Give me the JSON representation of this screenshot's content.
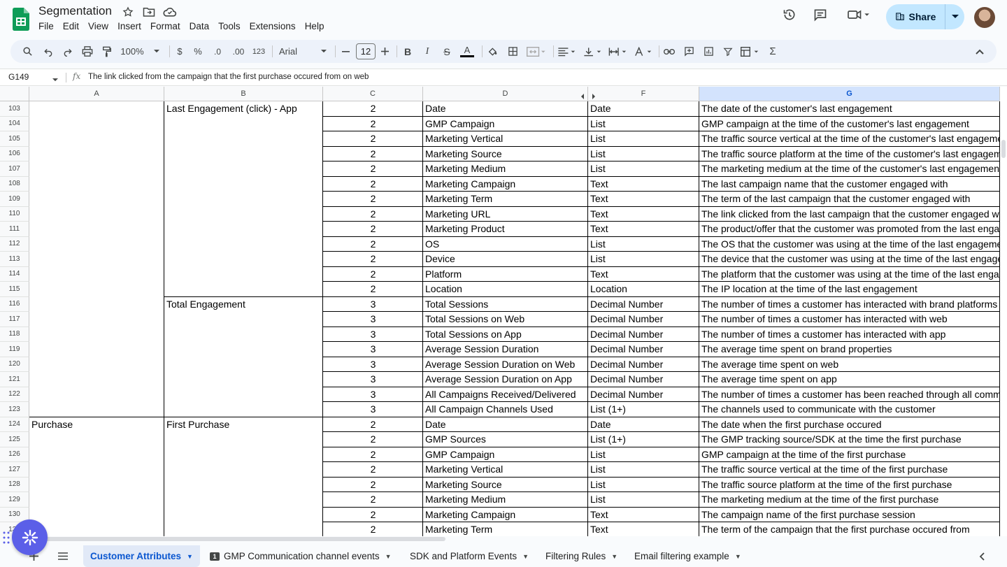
{
  "doc": {
    "title": "Segmentation",
    "menu": [
      "File",
      "Edit",
      "View",
      "Insert",
      "Format",
      "Data",
      "Tools",
      "Extensions",
      "Help"
    ],
    "share_label": "Share"
  },
  "toolbar": {
    "zoom": "100%",
    "currency": "$",
    "percent": "%",
    "dec_decrease": ".0",
    "dec_increase": ".00",
    "number_format": "123",
    "font": "Arial",
    "font_size": "12",
    "bold": "B",
    "italic": "I",
    "strike": "S",
    "text_color": "A",
    "sum": "Σ"
  },
  "formula_bar": {
    "cell_ref": "G149",
    "fx": "fx",
    "value": "The link clicked from the campaign that the first purchase occured from on web"
  },
  "columns": [
    "A",
    "B",
    "C",
    "D",
    "F",
    "G"
  ],
  "selected_column": "G",
  "rows": [
    {
      "n": "103",
      "a": "",
      "b": "Last Engagement (click) - App",
      "c": "2",
      "d": "Date",
      "f": "Date",
      "g": "The date of the customer's last engagement"
    },
    {
      "n": "104",
      "a": "",
      "b": "",
      "c": "2",
      "d": "GMP Campaign",
      "f": "List",
      "g": "GMP campaign at the time of the customer's last engagement"
    },
    {
      "n": "105",
      "a": "",
      "b": "",
      "c": "2",
      "d": "Marketing Vertical",
      "f": "List",
      "g": "The traffic source vertical at the time of the customer's last engagement"
    },
    {
      "n": "106",
      "a": "",
      "b": "",
      "c": "2",
      "d": "Marketing Source",
      "f": "List",
      "g": "The traffic source platform at the time of the customer's last engagement"
    },
    {
      "n": "107",
      "a": "",
      "b": "",
      "c": "2",
      "d": "Marketing Medium",
      "f": "List",
      "g": "The marketing medium at the time of the customer's last engagement"
    },
    {
      "n": "108",
      "a": "",
      "b": "",
      "c": "2",
      "d": "Marketing Campaign",
      "f": "Text",
      "g": "The last campaign name that the customer engaged with"
    },
    {
      "n": "109",
      "a": "",
      "b": "",
      "c": "2",
      "d": "Marketing Term",
      "f": "Text",
      "g": "The term of the last campaign that the customer engaged with"
    },
    {
      "n": "110",
      "a": "",
      "b": "",
      "c": "2",
      "d": "Marketing URL",
      "f": "Text",
      "g": "The link clicked from the last campaign that the customer engaged with"
    },
    {
      "n": "111",
      "a": "",
      "b": "",
      "c": "2",
      "d": "Marketing Product",
      "f": "Text",
      "g": "The product/offer that the customer was promoted from the last engagement"
    },
    {
      "n": "112",
      "a": "",
      "b": "",
      "c": "2",
      "d": "OS",
      "f": "List",
      "g": "The OS that the customer was using at the time of the last engagement"
    },
    {
      "n": "113",
      "a": "",
      "b": "",
      "c": "2",
      "d": "Device",
      "f": "List",
      "g": "The device that the customer was using at the time of the last engagement"
    },
    {
      "n": "114",
      "a": "",
      "b": "",
      "c": "2",
      "d": "Platform",
      "f": "Text",
      "g": "The platform that the customer was using at the time of the last engagement"
    },
    {
      "n": "115",
      "a": "",
      "b": "",
      "c": "2",
      "d": "Location",
      "f": "Location",
      "g": "The IP location at the time of the last engagement"
    },
    {
      "n": "116",
      "a": "",
      "b": "Total Engagement",
      "c": "3",
      "d": "Total Sessions",
      "f": "Decimal Number",
      "g": "The number of times a customer has interacted with brand platforms"
    },
    {
      "n": "117",
      "a": "",
      "b": "",
      "c": "3",
      "d": "Total Sessions on Web",
      "f": "Decimal Number",
      "g": "The number of times a customer has interacted with web"
    },
    {
      "n": "118",
      "a": "",
      "b": "",
      "c": "3",
      "d": "Total Sessions on App",
      "f": "Decimal Number",
      "g": "The number of times a customer has interacted with app"
    },
    {
      "n": "119",
      "a": "",
      "b": "",
      "c": "3",
      "d": "Average Session Duration",
      "f": "Decimal Number",
      "g": "The average time spent on brand properties"
    },
    {
      "n": "120",
      "a": "",
      "b": "",
      "c": "3",
      "d": "Average Session Duration on Web",
      "f": "Decimal Number",
      "g": "The average time spent on web"
    },
    {
      "n": "121",
      "a": "",
      "b": "",
      "c": "3",
      "d": "Average Session Duration on App",
      "f": "Decimal Number",
      "g": "The average time spent on app"
    },
    {
      "n": "122",
      "a": "",
      "b": "",
      "c": "3",
      "d": "All Campaigns Received/Delivered",
      "f": "Decimal Number",
      "g": "The number of times a customer has been reached through all communication"
    },
    {
      "n": "123",
      "a": "",
      "b": "",
      "c": "3",
      "d": "All Campaign Channels Used",
      "f": "List (1+)",
      "g": "The channels used to communicate with the customer"
    },
    {
      "n": "124",
      "a": "Purchase",
      "b": "First Purchase",
      "c": "2",
      "d": "Date",
      "f": "Date",
      "g": "The date when the first purchase occured"
    },
    {
      "n": "125",
      "a": "",
      "b": "",
      "c": "2",
      "d": "GMP Sources",
      "f": "List (1+)",
      "g": "The GMP tracking source/SDK at the time the first purchase"
    },
    {
      "n": "126",
      "a": "",
      "b": "",
      "c": "2",
      "d": "GMP Campaign",
      "f": "List",
      "g": "GMP campaign at the time of the first purchase"
    },
    {
      "n": "127",
      "a": "",
      "b": "",
      "c": "2",
      "d": "Marketing Vertical",
      "f": "List",
      "g": "The traffic source vertical at the time of the first purchase"
    },
    {
      "n": "128",
      "a": "",
      "b": "",
      "c": "2",
      "d": "Marketing Source",
      "f": "List",
      "g": "The traffic source platform at the time of the first purchase"
    },
    {
      "n": "129",
      "a": "",
      "b": "",
      "c": "2",
      "d": "Marketing Medium",
      "f": "List",
      "g": "The marketing medium at the time of the first purchase"
    },
    {
      "n": "130",
      "a": "",
      "b": "",
      "c": "2",
      "d": "Marketing Campaign",
      "f": "Text",
      "g": "The campaign name of the first purchase session"
    },
    {
      "n": "131",
      "a": "",
      "b": "",
      "c": "2",
      "d": "Marketing Term",
      "f": "Text",
      "g": "The term of the campaign that the first purchase occured from"
    }
  ],
  "tabs": [
    {
      "label": "Customer Attributes",
      "active": true
    },
    {
      "label": "GMP Communication channel events",
      "badge": "1"
    },
    {
      "label": "SDK and Platform Events"
    },
    {
      "label": "Filtering Rules"
    },
    {
      "label": "Email filtering example"
    }
  ],
  "colors": {
    "accent": "#0b57d0",
    "share_bg": "#c2e7ff",
    "selected_col": "#d3e3fd",
    "fab": "#5b5fe8",
    "logo_green": "#0f9d58"
  }
}
